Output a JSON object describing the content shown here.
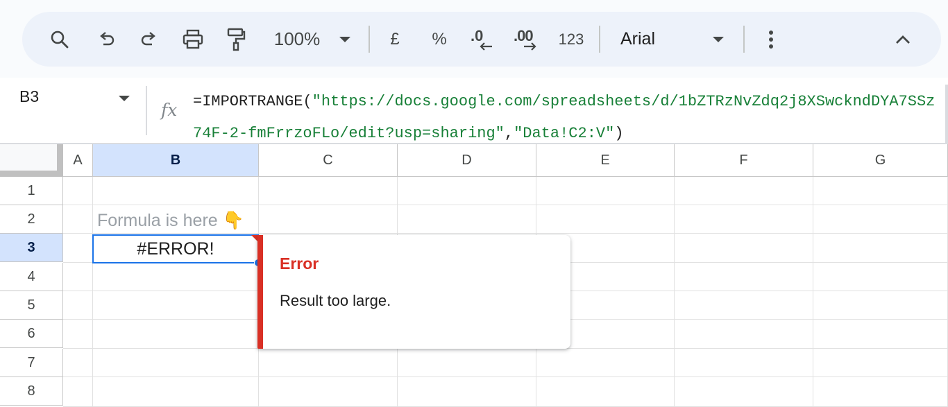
{
  "toolbar": {
    "zoom": "100%",
    "currency_symbol": "£",
    "percent_symbol": "%",
    "decrease_decimal": ".0",
    "increase_decimal": ".00",
    "number_format": "123",
    "font": "Arial"
  },
  "formula_bar": {
    "cell_ref": "B3",
    "fx_label": "fx",
    "formula_prefix": "=IMPORTRANGE(",
    "formula_url": "\"https://docs.google.com/spreadsheets/d/1bZTRzNvZdq2j8XSwckndDYA7SSz74F-2-fmFrrzoFLo/edit?usp=sharing\"",
    "formula_comma": ",",
    "formula_range": "\"Data!C2:V\"",
    "formula_suffix": ")"
  },
  "grid": {
    "columns": [
      "A",
      "B",
      "C",
      "D",
      "E",
      "F",
      "G"
    ],
    "rows": [
      "1",
      "2",
      "3",
      "4",
      "5",
      "6",
      "7",
      "8"
    ],
    "selected_column": "B",
    "selected_row": "3",
    "b2_text": "Formula is here 👇",
    "b3_value": "#ERROR!"
  },
  "error_popup": {
    "title": "Error",
    "message": "Result too large."
  },
  "colors": {
    "error_red": "#d93025",
    "selection_blue": "#1a73e8",
    "string_green": "#188038"
  }
}
